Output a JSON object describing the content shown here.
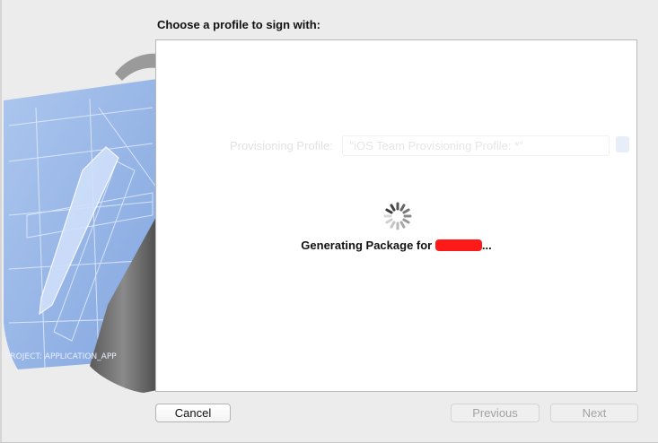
{
  "dialog": {
    "title": "Choose a profile to sign with:",
    "background_field": {
      "label": "Provisioning Profile:",
      "value": "\"iOS Team Provisioning Profile: *\""
    },
    "status": {
      "prefix": "Generating Package for ",
      "suffix": "..."
    }
  },
  "buttons": {
    "cancel": "Cancel",
    "previous": "Previous",
    "next": "Next"
  },
  "colors": {
    "accent": "#ff1a1a",
    "panel_bg": "#ffffff",
    "window_bg": "#ececec"
  },
  "icons": [
    "spinner-icon",
    "xcode-blueprint-icon"
  ]
}
